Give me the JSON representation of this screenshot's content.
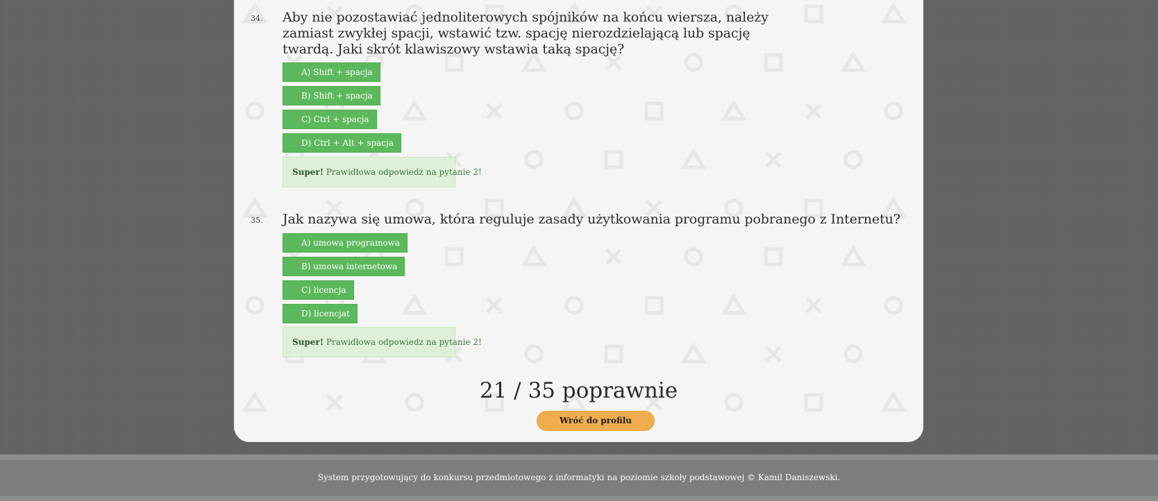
{
  "questions": [
    {
      "number": "34.",
      "text": "Aby nie pozostawiać jednoliterowych spójników na końcu wiersza, należy zamiast zwykłej spacji, wstawić tzw. spację nierozdzielającą lub spację twardą. Jaki skrót klawiszowy wstawia taką spację?",
      "answers": [
        "A) Shift + spacja",
        "B) Shift + spacja",
        "C) Ctrl + spacja",
        "D) Ctrl + Alt + spacja"
      ],
      "feedback_strong": "Super!",
      "feedback_text": "Prawidłowa odpowiedz na pytanie 2!"
    },
    {
      "number": "35.",
      "text": "Jak nazywa się umowa, która reguluje zasady użytkowania programu pobranego z Internetu?",
      "answers": [
        "A) umowa programowa",
        "B) umowa internetowa",
        "C) licencja",
        "D) licencjat"
      ],
      "feedback_strong": "Super!",
      "feedback_text": "Prawidłowa odpowiedz na pytanie 2!"
    }
  ],
  "score_text": "21 / 35 poprawnie",
  "back_button_label": "Wróć do profilu",
  "footer_text": "System przygotowujący do konkursu przedmiotowego z informatyki na poziomie szkoły podstawowej © Kamil Daniszewski.",
  "colors": {
    "answer_button": "#5cb85c",
    "success_alert": "#dff0d8",
    "back_button": "#f0ad4e",
    "card_background": "#f5f5f5",
    "page_background": "#636363"
  },
  "background_pattern_icons": [
    "triangle-icon",
    "circle-icon",
    "cross-icon",
    "square-icon"
  ]
}
